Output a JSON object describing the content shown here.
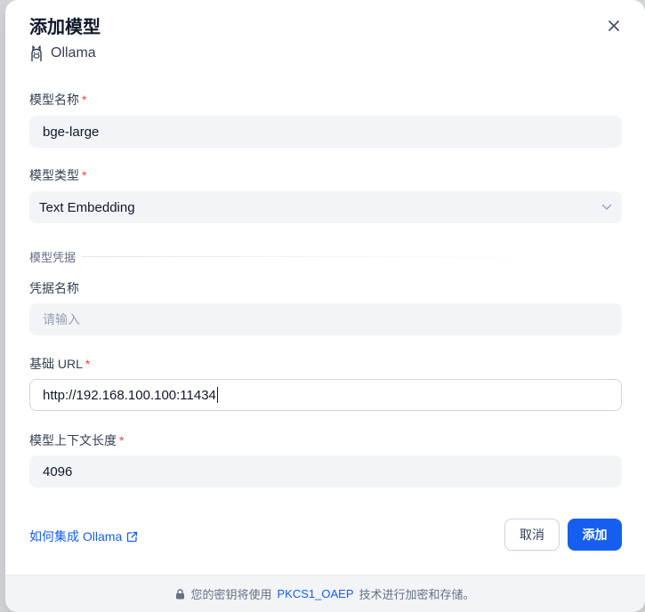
{
  "dialog": {
    "title": "添加模型",
    "provider_name": "Ollama"
  },
  "fields": {
    "model_name": {
      "label": "模型名称",
      "required": "*",
      "value": "bge-large"
    },
    "model_type": {
      "label": "模型类型",
      "required": "*",
      "value": "Text Embedding"
    },
    "credentials_section": "模型凭据",
    "credential_name": {
      "label": "凭据名称",
      "placeholder": "请输入",
      "value": ""
    },
    "base_url": {
      "label": "基础 URL",
      "required": "*",
      "value": "http://192.168.100.100:11434"
    },
    "context_length": {
      "label": "模型上下文长度",
      "required": "*",
      "value": "4096"
    }
  },
  "help_link": "如何集成 Ollama",
  "buttons": {
    "cancel": "取消",
    "add": "添加"
  },
  "footer": {
    "prefix": "您的密钥将使用",
    "keyword": "PKCS1_OAEP",
    "suffix": "技术进行加密和存储。"
  },
  "colors": {
    "primary": "#155eef",
    "required": "#f04438",
    "input_bg": "#f2f4f7"
  },
  "icons": [
    "ollama-llama-icon",
    "close-icon",
    "chevron-down-icon",
    "external-link-icon",
    "lock-icon"
  ]
}
